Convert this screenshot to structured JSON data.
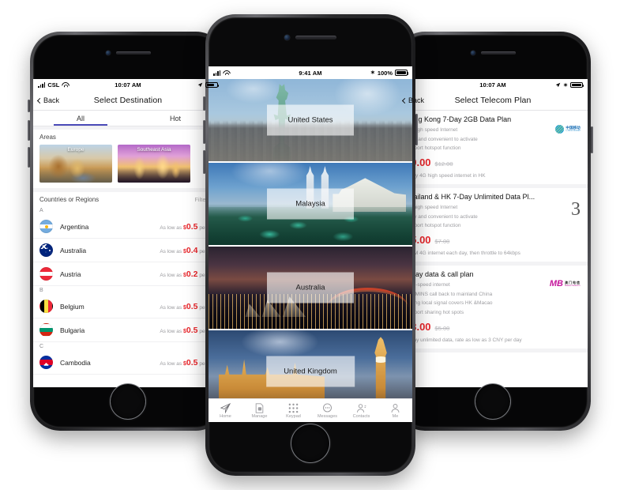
{
  "left_phone": {
    "status": {
      "carrier": "CSL",
      "time": "10:07 AM",
      "battery": ""
    },
    "nav": {
      "back": "Back",
      "title": "Select Destination"
    },
    "tabs": [
      {
        "label": "All",
        "active": true
      },
      {
        "label": "Hot",
        "active": false
      }
    ],
    "areas": {
      "title": "Areas",
      "cards": [
        {
          "label": "Europe"
        },
        {
          "label": "Southeast Asia"
        }
      ]
    },
    "countries_header": {
      "title": "Countries or Regions",
      "filter": "Filter"
    },
    "groups": [
      {
        "letter": "A",
        "rows": [
          {
            "name": "Argentina",
            "prefix": "As low as",
            "currency": "$",
            "amount": "0.5",
            "suffix": "per day",
            "flag": "f-ar"
          },
          {
            "name": "Australia",
            "prefix": "As low as",
            "currency": "$",
            "amount": "0.4",
            "suffix": "per day",
            "flag": "f-au"
          },
          {
            "name": "Austria",
            "prefix": "As low as",
            "currency": "$",
            "amount": "0.2",
            "suffix": "per day",
            "flag": "f-at"
          }
        ]
      },
      {
        "letter": "B",
        "rows": [
          {
            "name": "Belgium",
            "prefix": "As low as",
            "currency": "$",
            "amount": "0.5",
            "suffix": "per day",
            "flag": "f-be"
          },
          {
            "name": "Bulgaria",
            "prefix": "As low as",
            "currency": "$",
            "amount": "0.5",
            "suffix": "per day",
            "flag": "f-bg"
          }
        ]
      },
      {
        "letter": "C",
        "rows": [
          {
            "name": "Cambodia",
            "prefix": "As low as",
            "currency": "$",
            "amount": "0.5",
            "suffix": "per day",
            "flag": "f-kh"
          }
        ]
      }
    ]
  },
  "center_phone": {
    "status": {
      "time": "9:41 AM",
      "battery": "100%",
      "bluetooth": "✶"
    },
    "cards": [
      {
        "label": "United States",
        "bg": "bg-us"
      },
      {
        "label": "Malaysia",
        "bg": "bg-my"
      },
      {
        "label": "Australia",
        "bg": "bg-au"
      },
      {
        "label": "United Kingdom",
        "bg": "bg-uk"
      }
    ],
    "tabbar": [
      {
        "label": "Home",
        "icon": "paper-plane-icon"
      },
      {
        "label": "Manage",
        "icon": "sim-card-icon"
      },
      {
        "label": "Keypad",
        "icon": "keypad-icon"
      },
      {
        "label": "Messages",
        "icon": "chat-bubble-icon"
      },
      {
        "label": "Contacts",
        "icon": "contacts-icon"
      },
      {
        "label": "Me",
        "icon": "person-icon"
      }
    ]
  },
  "right_phone": {
    "status": {
      "time": "10:07 AM"
    },
    "nav": {
      "back": "Back",
      "title": "Select Telecom Plan"
    },
    "plans": [
      {
        "title": "Hong Kong 7-Day 2GB Data Plan",
        "features": [
          "4G high speed Internet",
          "Easy and convenient to activate",
          "Support hotspot function"
        ],
        "price_now": "$9.00",
        "price_old": "$12.00",
        "note": "Enjoy 4G high speed internet in HK",
        "carrier_logo": "china-mobile-logo",
        "logo_text": {
          "cn": "中国移动",
          "en": "China Mobile"
        }
      },
      {
        "title": "Thailand & HK 7-Day Unlimited Data Pl...",
        "features": [
          "4G high speed Internet",
          "Easy and convenient to activate",
          "Support hotspot function"
        ],
        "price_now": "$5.00",
        "price_old": "$7.00",
        "note": "500M 4G internet each day, then throttle to 64kbps",
        "carrier_logo": "three-logo",
        "logo_text": {
          "mark": "3"
        }
      },
      {
        "title": "7-day data & call plan",
        "features": [
          "High-speed internet",
          "250 MINS call back to mainland China",
          "Strong local signal covers HK &Macao",
          "Support sharing hot spots"
        ],
        "price_now": "$3.00",
        "price_old": "$5.00",
        "note": "7-Day unlimited data, rate as low as 3 CNY per day",
        "carrier_logo": "mb-macau-logo",
        "logo_text": {
          "mark": "MB",
          "cn": "澳门电信",
          "en": "Macau Telecom"
        }
      }
    ]
  },
  "colors": {
    "accent_red": "#e8252a",
    "tab_underline": "#4b4bb8",
    "muted": "#9d9da1",
    "china_mobile": "#1a6fb5",
    "mb_magenta": "#c5169c"
  }
}
